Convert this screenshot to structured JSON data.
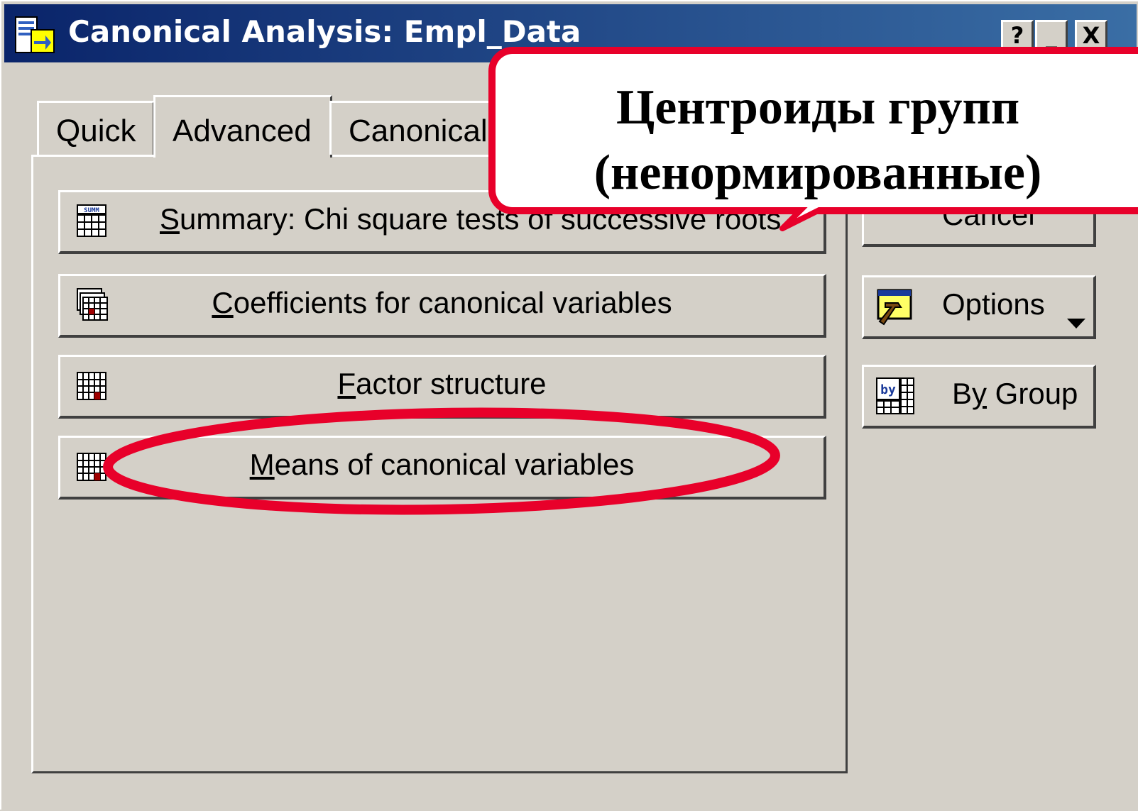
{
  "window": {
    "title": "Canonical Analysis: Empl_Data",
    "help_label": "?",
    "minimize_label": "_",
    "close_label": "X"
  },
  "tabs": [
    {
      "label": "Quick"
    },
    {
      "label": "Advanced"
    },
    {
      "label": "Canonical"
    }
  ],
  "main_buttons": {
    "summary": {
      "hotkey": "S",
      "rest": "ummary:  Chi square tests of successive roots",
      "icon_text": "SUMM"
    },
    "coefficients": {
      "hotkey": "C",
      "rest": "oefficients for canonical variables"
    },
    "factor": {
      "hotkey": "F",
      "rest": "actor structure"
    },
    "means": {
      "hotkey": "M",
      "rest": "eans of canonical variables"
    }
  },
  "side_buttons": {
    "cancel": {
      "label": "Cancel"
    },
    "options": {
      "label": "Options"
    },
    "bygroup": {
      "pre": "B",
      "hotkey": "y",
      "post": " Group",
      "icon_text": "by"
    }
  },
  "callout": {
    "line1": "Центроиды групп",
    "line2": "(ненормированные)",
    "color": "#e8002a"
  },
  "highlight": {
    "color": "#e8002a",
    "target": "means-of-canonical-variables-button"
  }
}
